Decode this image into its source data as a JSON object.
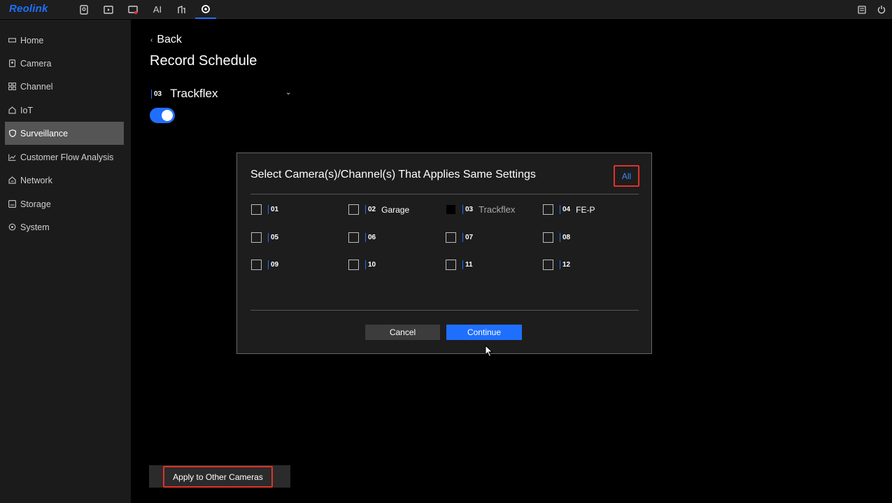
{
  "brand": {
    "name": "Reolink",
    "accent": "#1f6fff",
    "highlight": "#e0312b"
  },
  "topbar": {
    "icons": [
      "camera-icon",
      "playback-icon",
      "alarm-icon",
      "ai-icon",
      "devices-icon",
      "settings-icon",
      "notes-icon",
      "power-icon"
    ],
    "ai_label": "AI",
    "active": "settings-icon"
  },
  "sidebar": {
    "items": [
      {
        "label": "Home",
        "icon": "home-icon"
      },
      {
        "label": "Camera",
        "icon": "camera-icon"
      },
      {
        "label": "Channel",
        "icon": "grid-icon"
      },
      {
        "label": "IoT",
        "icon": "house-icon"
      },
      {
        "label": "Surveillance",
        "icon": "shield-icon",
        "active": true
      },
      {
        "label": "Customer Flow Analysis",
        "icon": "chart-icon"
      },
      {
        "label": "Network",
        "icon": "network-icon"
      },
      {
        "label": "Storage",
        "icon": "storage-icon"
      },
      {
        "label": "System",
        "icon": "gear-icon"
      }
    ]
  },
  "main": {
    "back_label": "Back",
    "title": "Record Schedule",
    "camera": {
      "channel": "03",
      "name": "Trackflex"
    },
    "toggle_on": true,
    "apply_button": "Apply to Other Cameras"
  },
  "modal": {
    "title": "Select Camera(s)/Channel(s) That Applies Same Settings",
    "all_label": "All",
    "channels": [
      {
        "num": "01",
        "name": ""
      },
      {
        "num": "02",
        "name": "Garage"
      },
      {
        "num": "03",
        "name": "Trackflex",
        "disabled": true
      },
      {
        "num": "04",
        "name": "FE-P"
      },
      {
        "num": "05",
        "name": ""
      },
      {
        "num": "06",
        "name": ""
      },
      {
        "num": "07",
        "name": ""
      },
      {
        "num": "08",
        "name": ""
      },
      {
        "num": "09",
        "name": ""
      },
      {
        "num": "10",
        "name": ""
      },
      {
        "num": "11",
        "name": ""
      },
      {
        "num": "12",
        "name": ""
      }
    ],
    "cancel_label": "Cancel",
    "continue_label": "Continue"
  }
}
